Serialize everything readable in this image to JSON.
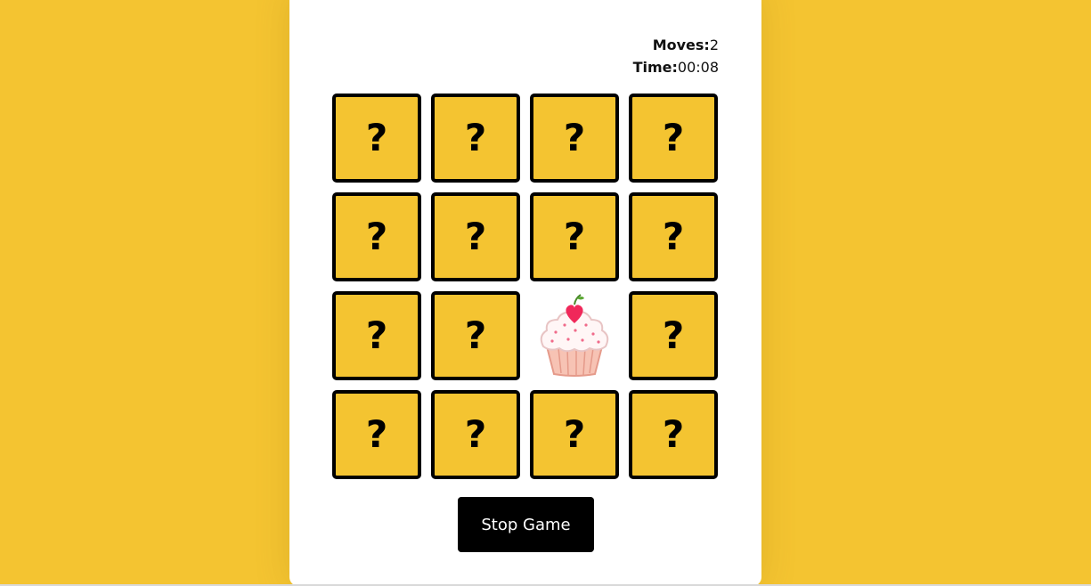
{
  "stats": {
    "moves_label": "Moves:",
    "moves_value": "2",
    "time_label": "Time:",
    "time_value": "00:08"
  },
  "cards": [
    {
      "state": "hidden",
      "symbol": "?"
    },
    {
      "state": "hidden",
      "symbol": "?"
    },
    {
      "state": "hidden",
      "symbol": "?"
    },
    {
      "state": "hidden",
      "symbol": "?"
    },
    {
      "state": "hidden",
      "symbol": "?"
    },
    {
      "state": "hidden",
      "symbol": "?"
    },
    {
      "state": "hidden",
      "symbol": "?"
    },
    {
      "state": "hidden",
      "symbol": "?"
    },
    {
      "state": "hidden",
      "symbol": "?"
    },
    {
      "state": "hidden",
      "symbol": "?"
    },
    {
      "state": "revealed",
      "image": "cupcake-icon"
    },
    {
      "state": "hidden",
      "symbol": "?"
    },
    {
      "state": "hidden",
      "symbol": "?"
    },
    {
      "state": "hidden",
      "symbol": "?"
    },
    {
      "state": "hidden",
      "symbol": "?"
    },
    {
      "state": "hidden",
      "symbol": "?"
    }
  ],
  "controls": {
    "stop_label": "Stop Game"
  },
  "colors": {
    "background": "#f4c431",
    "card": "#f4c431",
    "button": "#000000"
  }
}
